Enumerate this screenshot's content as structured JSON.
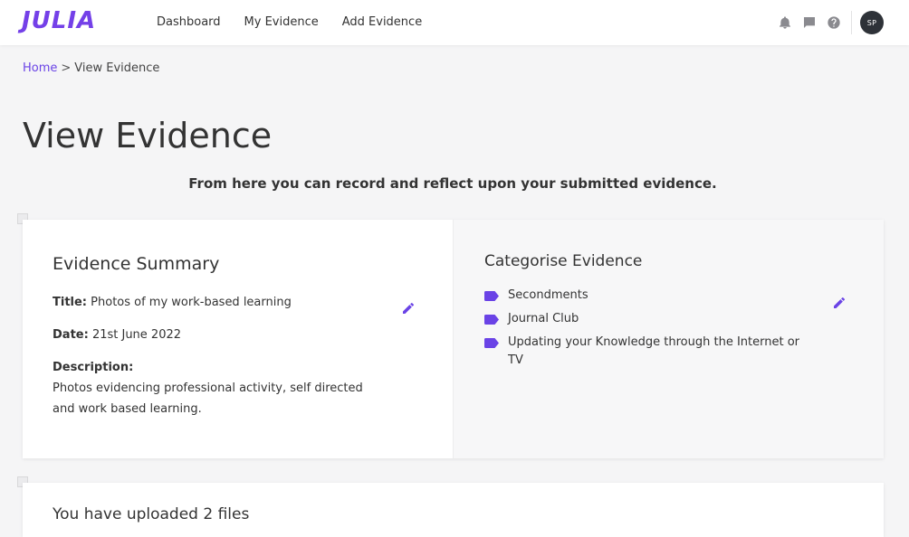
{
  "brand": {
    "logo_text": "JULIA",
    "accent": "#6a43e6"
  },
  "nav": {
    "items": [
      {
        "label": "Dashboard"
      },
      {
        "label": "My Evidence"
      },
      {
        "label": "Add Evidence"
      }
    ]
  },
  "header_icons": [
    "bell-icon",
    "chat-icon",
    "help-icon"
  ],
  "user": {
    "initials": "SP"
  },
  "breadcrumb": {
    "home": "Home",
    "separator": ">",
    "current": "View Evidence"
  },
  "page": {
    "title": "View Evidence",
    "subtitle": "From here you can record and reflect upon your submitted evidence."
  },
  "summary": {
    "heading": "Evidence Summary",
    "title_label": "Title:",
    "title_value": "Photos of my work-based learning",
    "date_label": "Date:",
    "date_value": "21st June 2022",
    "description_label": "Description:",
    "description_value": "Photos evidencing professional activity, self directed and work based learning."
  },
  "categorise": {
    "heading": "Categorise Evidence",
    "categories": [
      {
        "label": "Secondments"
      },
      {
        "label": "Journal Club"
      },
      {
        "label": "Updating your Knowledge through the Internet or TV"
      }
    ]
  },
  "files": {
    "heading": "You have uploaded 2 files"
  }
}
